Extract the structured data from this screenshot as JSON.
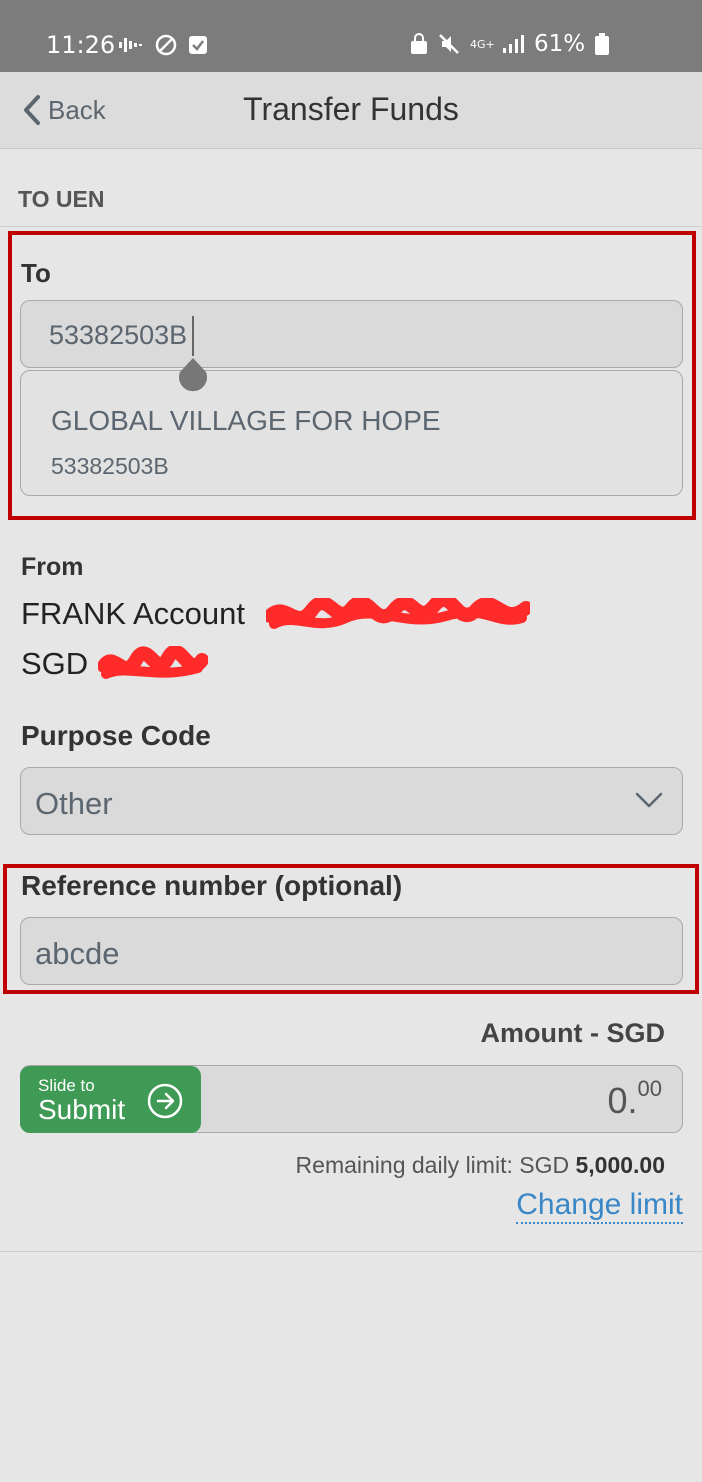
{
  "status_bar": {
    "time": "11:26",
    "network": "4G+",
    "battery": "61%"
  },
  "nav": {
    "back_label": "Back",
    "title": "Transfer Funds"
  },
  "section": {
    "title": "TO UEN"
  },
  "to": {
    "label": "To",
    "value": "53382503B",
    "suggestion": {
      "name": "GLOBAL VILLAGE FOR HOPE",
      "id": "53382503B"
    }
  },
  "from": {
    "label": "From",
    "account": "FRANK Account",
    "currency": "SGD"
  },
  "purpose": {
    "label": "Purpose Code",
    "value": "Other"
  },
  "reference": {
    "label": "Reference number (optional)",
    "value": "abcde"
  },
  "amount": {
    "label": "Amount - SGD",
    "whole": "0.",
    "decimal": "00"
  },
  "slide": {
    "small": "Slide to",
    "big": "Submit"
  },
  "limit": {
    "prefix": "Remaining daily limit: SGD ",
    "amount": "5,000.00",
    "change_label": "Change limit"
  },
  "colors": {
    "accent_green": "#3e9a55",
    "link_blue": "#3a87c8",
    "highlight_red": "#c00000"
  }
}
